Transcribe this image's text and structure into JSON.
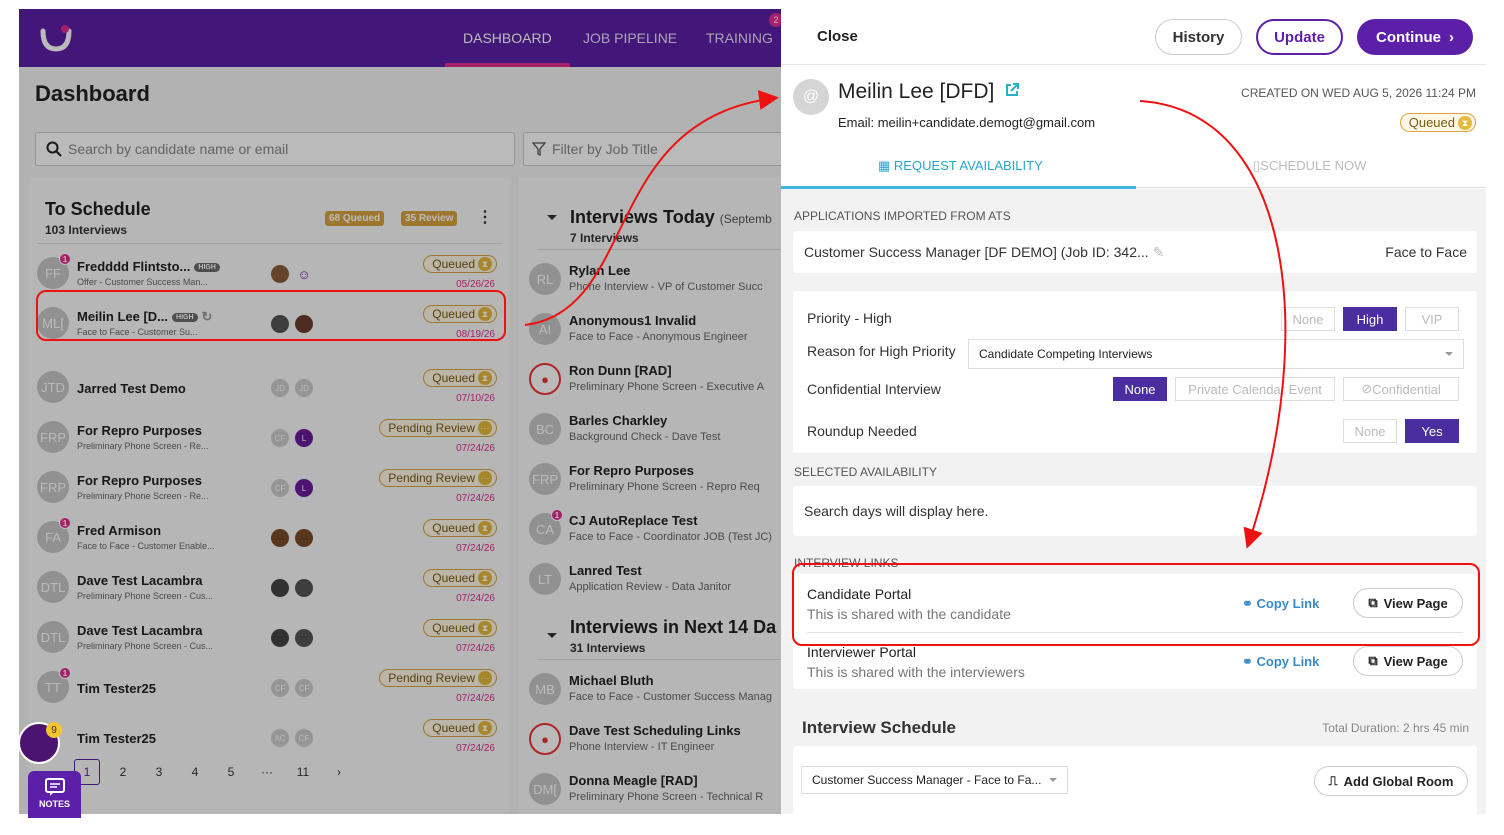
{
  "nav": {
    "items": [
      "DASHBOARD",
      "JOB PIPELINE",
      "TRAINING"
    ],
    "badge": "2"
  },
  "dashboard": {
    "title": "Dashboard",
    "search_placeholder": "Search by candidate name or email",
    "filter_placeholder": "Filter by Job Title"
  },
  "to_schedule": {
    "title": "To Schedule",
    "subtitle": "103 Interviews",
    "queued_pill": "68 Queued",
    "review_pill": "35 Review",
    "rows": [
      {
        "initials": "FF",
        "dot": "1",
        "name": "Fredddd Flintsto...",
        "high": "HIGH",
        "sub": "Offer - Customer Success Man...",
        "status": "Queued",
        "date": "05/26/26"
      },
      {
        "initials": "ML[",
        "dot": "",
        "name": "Meilin Lee [D...",
        "high": "HIGH",
        "sub": "Face to Face - Customer Su...",
        "status": "Queued",
        "date": "08/19/26"
      },
      {
        "initials": "JTD",
        "dot": "",
        "name": "Jarred Test Demo",
        "high": "",
        "sub": "",
        "status": "Queued",
        "date": "07/10/26",
        "m1": "JD",
        "m2": "JD"
      },
      {
        "initials": "FRP",
        "dot": "",
        "name": "For Repro Purposes",
        "high": "",
        "sub": "Preliminary Phone Screen - Re...",
        "status": "Pending Review",
        "date": "07/24/26",
        "m1": "CF",
        "m2": "L"
      },
      {
        "initials": "FRP",
        "dot": "",
        "name": "For Repro Purposes",
        "high": "",
        "sub": "Preliminary Phone Screen - Re...",
        "status": "Pending Review",
        "date": "07/24/26",
        "m1": "CF",
        "m2": "L"
      },
      {
        "initials": "FA",
        "dot": "1",
        "name": "Fred Armison",
        "high": "",
        "sub": "Face to Face - Customer Enable...",
        "status": "Queued",
        "date": "07/24/26"
      },
      {
        "initials": "DTL",
        "dot": "",
        "name": "Dave Test Lacambra",
        "high": "",
        "sub": "Preliminary Phone Screen - Cus...",
        "status": "Queued",
        "date": "07/24/26"
      },
      {
        "initials": "DTL",
        "dot": "",
        "name": "Dave Test Lacambra",
        "high": "",
        "sub": "Preliminary Phone Screen - Cus...",
        "status": "Queued",
        "date": "07/24/26"
      },
      {
        "initials": "TT",
        "dot": "1",
        "name": "Tim Tester25",
        "high": "",
        "sub": "",
        "status": "Pending Review",
        "date": "07/24/26",
        "m1": "CF",
        "m2": "CF"
      },
      {
        "initials": "",
        "dot": "",
        "name": "Tim Tester25",
        "high": "",
        "sub": "",
        "status": "Queued",
        "date": "07/24/26",
        "m1": "AC",
        "m2": "CF"
      }
    ],
    "pager": [
      "1",
      "2",
      "3",
      "4",
      "5",
      "···",
      "11",
      "›"
    ]
  },
  "interviews_today": {
    "title": "Interviews Today",
    "title_suffix": "(Septemb",
    "subtitle": "7 Interviews",
    "rows": [
      {
        "initials": "RL",
        "name": "Rylan Lee",
        "sub": "Phone Interview - VP of Customer Succ"
      },
      {
        "initials": "AI",
        "name": "Anonymous1 Invalid",
        "sub": "Face to Face - Anonymous Engineer"
      },
      {
        "initials": "",
        "name": "Ron Dunn [RAD]",
        "sub": "Preliminary Phone Screen - Executive A"
      },
      {
        "initials": "BC",
        "name": "Barles Charkley",
        "sub": "Background Check - Dave Test"
      },
      {
        "initials": "FRP",
        "name": "For Repro Purposes",
        "sub": "Preliminary Phone Screen - Repro Req"
      },
      {
        "initials": "CA",
        "name": "CJ AutoReplace Test",
        "sub": "Face to Face - Coordinator JOB (Test JC)"
      },
      {
        "initials": "LT",
        "name": "Lanred Test",
        "sub": "Application Review - Data Janitor"
      }
    ]
  },
  "interviews_next": {
    "title": "Interviews in Next 14 Da",
    "subtitle": "31 Interviews",
    "rows": [
      {
        "initials": "MB",
        "name": "Michael Bluth",
        "sub": "Face to Face - Customer Success Manag"
      },
      {
        "initials": "",
        "name": "Dave Test Scheduling Links",
        "sub": "Phone Interview - IT Engineer"
      },
      {
        "initials": "DM[",
        "name": "Donna Meagle [RAD]",
        "sub": "Preliminary Phone Screen - Technical R"
      }
    ]
  },
  "notes_label": "NOTES",
  "helper_count": "9",
  "drawer": {
    "close": "Close",
    "history": "History",
    "update": "Update",
    "continue": "Continue",
    "candidate_initial": "@",
    "candidate_name": "Meilin Lee [DFD]",
    "email": "Email: meilin+candidate.demogt@gmail.com",
    "created": "CREATED ON WED AUG 5, 2026 11:24 PM",
    "status": "Queued",
    "tab_request": "REQUEST AVAILABILITY",
    "tab_schedule": "SCHEDULE NOW",
    "apps_title": "APPLICATIONS IMPORTED FROM ATS",
    "app_name": "Customer Success Manager [DF DEMO] (Job ID: 342...",
    "app_type": "Face to Face",
    "priority_label": "Priority - High",
    "priority_opts": [
      "None",
      "High",
      "VIP"
    ],
    "reason_label": "Reason for High Priority",
    "reason_value": "Candidate Competing Interviews",
    "conf_label": "Confidential Interview",
    "conf_opts": [
      "None",
      "Private Calendar Event",
      "Confidential"
    ],
    "roundup_label": "Roundup Needed",
    "roundup_opts": [
      "None",
      "Yes"
    ],
    "avail_title": "SELECTED AVAILABILITY",
    "avail_text": "Search days will display here.",
    "links_title": "INTERVIEW LINKS",
    "cand_portal": "Candidate Portal",
    "cand_portal_desc": "This is shared with the candidate",
    "int_portal": "Interviewer Portal",
    "int_portal_desc": "This is shared with the interviewers",
    "copy_link": "Copy Link",
    "view_page": "View Page",
    "sched_title": "Interview Schedule",
    "duration": "Total Duration: 2 hrs 45 min",
    "sched_select": "Customer Success Manager - Face to Fa...",
    "add_room": "Add Global Room"
  },
  "colors": {
    "brand": "#5c1fa8",
    "accent": "#e22d8f",
    "teal": "#28a6c9",
    "queued": "#d9a441",
    "annotation": "#e11111"
  }
}
